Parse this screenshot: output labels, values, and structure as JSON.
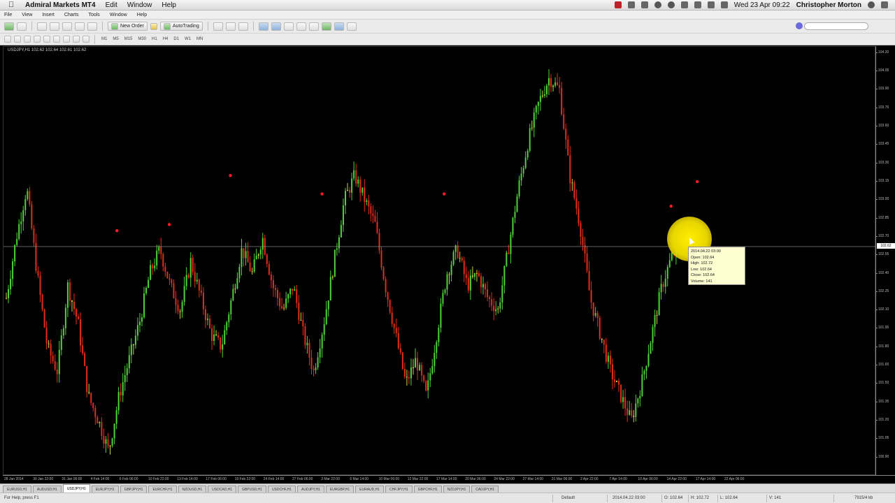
{
  "macbar": {
    "app_name": "Admiral Markets MT4",
    "menus": [
      "Edit",
      "Window",
      "Help"
    ],
    "datetime": "Wed 23 Apr 09:22",
    "user": "Christopher Morton"
  },
  "winmenu": [
    "File",
    "View",
    "Insert",
    "Charts",
    "Tools",
    "Window",
    "Help"
  ],
  "toolbar": {
    "new_order": "New Order",
    "autotrading": "AutoTrading",
    "timeframes": [
      "M1",
      "M5",
      "M15",
      "M30",
      "H1",
      "H4",
      "D1",
      "W1",
      "MN"
    ]
  },
  "chart": {
    "header": "USDJPY,H1  102.62 102.64 102.61 102.62",
    "current_price": "102.62",
    "tooltip": {
      "date": "2014.04.22 03:00",
      "open": "Open: 102.64",
      "high": "High: 102.72",
      "low": "Low: 102.64",
      "close": "Close: 102.64",
      "volume": "Volume: 141"
    }
  },
  "chart_data": {
    "type": "candlestick",
    "symbol": "USDJPY",
    "timeframe": "H1",
    "ylim": [
      100.75,
      104.25
    ],
    "yticks": [
      "104.20",
      "104.05",
      "103.90",
      "103.75",
      "103.60",
      "103.45",
      "103.30",
      "103.15",
      "103.00",
      "102.85",
      "102.70",
      "102.55",
      "102.40",
      "102.25",
      "102.10",
      "101.95",
      "101.80",
      "101.65",
      "101.50",
      "101.35",
      "101.20",
      "101.05",
      "100.90"
    ],
    "xticks": [
      "28 Jan 2014",
      "30 Jan 22:00",
      "31 Jan 06:00",
      "4 Feb 14:00",
      "6 Feb 06:00",
      "10 Feb 22:00",
      "13 Feb 14:00",
      "17 Feb 06:00",
      "19 Feb 22:00",
      "24 Feb 14:00",
      "27 Feb 06:00",
      "3 Mar 22:00",
      "6 Mar 14:00",
      "10 Mar 06:00",
      "12 Mar 22:00",
      "17 Mar 14:00",
      "20 Mar 06:00",
      "24 Mar 22:00",
      "27 Mar 14:00",
      "31 Mar 06:00",
      "2 Apr 22:00",
      "7 Apr 14:00",
      "10 Apr 06:00",
      "14 Apr 22:00",
      "17 Apr 14:00",
      "22 Apr 06:00"
    ],
    "closes": [
      102.2,
      102.7,
      103.1,
      102.4,
      101.8,
      101.6,
      102.3,
      102.0,
      101.4,
      101.2,
      100.95,
      101.4,
      101.7,
      102.0,
      102.4,
      102.6,
      102.3,
      102.1,
      102.5,
      102.2,
      101.9,
      101.8,
      102.2,
      102.6,
      102.4,
      102.7,
      102.3,
      102.1,
      102.3,
      101.9,
      101.6,
      102.0,
      102.5,
      103.0,
      103.2,
      103.0,
      102.8,
      102.3,
      101.9,
      101.5,
      101.7,
      101.4,
      101.9,
      102.4,
      102.6,
      102.3,
      102.4,
      102.2,
      102.1,
      102.6,
      103.1,
      103.5,
      103.8,
      104.0,
      103.9,
      103.2,
      102.8,
      102.2,
      101.9,
      101.6,
      101.4,
      101.2,
      101.5,
      101.9,
      102.3,
      102.55,
      102.62
    ],
    "fractal_markers": [
      {
        "x": 0.13,
        "y": 102.75
      },
      {
        "x": 0.19,
        "y": 102.8
      },
      {
        "x": 0.26,
        "y": 103.2
      },
      {
        "x": 0.365,
        "y": 103.05
      },
      {
        "x": 0.505,
        "y": 103.05
      },
      {
        "x": 0.765,
        "y": 102.95
      },
      {
        "x": 0.795,
        "y": 103.15
      }
    ],
    "up_color": "#4fd23a",
    "down_color": "#e02e1a",
    "neutral_color": "#c9d24a"
  },
  "tabs": [
    "EURUSD,H1",
    "AUDUSD,H1",
    "USDJPY,H1",
    "EURJPY,H1",
    "GBPJPY,H1",
    "EURCHF,H1",
    "NZDUSD,H1",
    "USDCAD,H1",
    "GBPUSD,H1",
    "USDCHF,H1",
    "AUDJPY,H1",
    "EURGBP,H1",
    "EURAUD,H1",
    "CHFJPY,H1",
    "GBPCHF,H1",
    "NZDJPY,H1",
    "CADJPY,H1"
  ],
  "active_tab": 2,
  "status": {
    "help": "For Help, press F1",
    "profile": "Default",
    "datetime": "2014.04.22 03:00",
    "open": "O: 102.64",
    "high": "H: 102.72",
    "low": "L: 102.64",
    "volume": "V: 141",
    "traffic": "7915/4 kb"
  }
}
